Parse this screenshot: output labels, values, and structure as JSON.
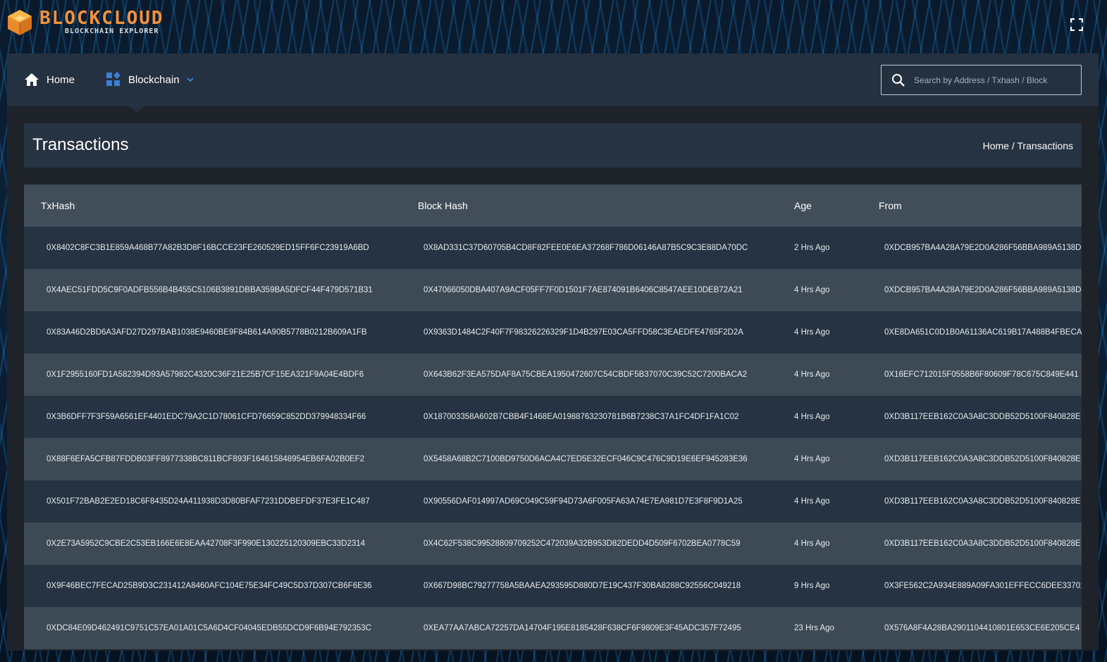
{
  "brand": {
    "name": "BLOCKCLOUD",
    "tagline": "BLOCKCHAIN EXPLORER",
    "accent": "#f4923a"
  },
  "nav": {
    "home_label": "Home",
    "blockchain_label": "Blockchain",
    "search_placeholder": "Search by Address / Txhash / Block"
  },
  "page": {
    "title": "Transactions",
    "breadcrumb_home": "Home",
    "breadcrumb_sep": "/",
    "breadcrumb_current": "Transactions"
  },
  "table": {
    "headers": {
      "txhash": "TxHash",
      "block_hash": "Block Hash",
      "age": "Age",
      "from": "From"
    },
    "rows": [
      {
        "txhash": "0X8402C8FC3B1E859A468B77A82B3D8F16BCCE23FE260529ED15FF6FC23919A6BD",
        "block_hash": "0X8AD331C37D60705B4CD8F82FEE0E6EA37268F786D06146A87B5C9C3E88DA70DC",
        "age": "2 Hrs Ago",
        "from": "0XDCB957BA4A28A79E2D0A286F56BBA989A5138D"
      },
      {
        "txhash": "0X4AEC51FDD5C9F0ADFB556B4B455C5106B3891DBBA359BA5DFCF44F479D571B31",
        "block_hash": "0X47066050DBA407A9ACF05FF7F0D1501F7AE874091B6406C8547AEE10DEB72A21",
        "age": "4 Hrs Ago",
        "from": "0XDCB957BA4A28A79E2D0A286F56BBA989A5138D"
      },
      {
        "txhash": "0X83A46D2BD6A3AFD27D297BAB1038E9460BE9F84B614A90B5778B0212B609A1FB",
        "block_hash": "0X9363D1484C2F40F7F98326226329F1D4B297E03CA5FFD58C3EAEDFE4765F2D2A",
        "age": "4 Hrs Ago",
        "from": "0XE8DA651C0D1B0A61136AC619B17A488B4FBECA"
      },
      {
        "txhash": "0X1F2955160FD1A582394D93A57982C4320C36F21E25B7CF15EA321F9A04E4BDF6",
        "block_hash": "0X643B62F3EA575DAF8A75CBEA1950472607C54CBDF5B37070C39C52C7200BACA2",
        "age": "4 Hrs Ago",
        "from": "0X16EFC712015F0558B6F80609F78C675C849E441"
      },
      {
        "txhash": "0X3B6DFF7F3F59A6561EF4401EDC79A2C1D78061CFD76659C852DD379948334F66",
        "block_hash": "0X187003358A602B7CBB4F1468EA01988763230781B6B7238C37A1FC4DF1FA1C02",
        "age": "4 Hrs Ago",
        "from": "0XD3B117EEB162C0A3A8C3DDB52D5100F840828E"
      },
      {
        "txhash": "0X88F6EFA5CFB87FDDB03FF8977338BC811BCF893F164615848954EB6FA02B0EF2",
        "block_hash": "0X5458A68B2C7100BD9750D6ACA4C7ED5E32ECF046C9C476C9D19E6EF945283E36",
        "age": "4 Hrs Ago",
        "from": "0XD3B117EEB162C0A3A8C3DDB52D5100F840828E"
      },
      {
        "txhash": "0X501F72BAB2E2ED18C6F8435D24A411938D3D80BFAF7231DDBEFDF37E3FE1C487",
        "block_hash": "0X90556DAF014997AD69C049C59F94D73A6F005FA63A74E7EA981D7E3F8F9D1A25",
        "age": "4 Hrs Ago",
        "from": "0XD3B117EEB162C0A3A8C3DDB52D5100F840828E"
      },
      {
        "txhash": "0X2E73A5952C9CBE2C53EB166E6E8EAA42708F3F990E130225120309EBC33D2314",
        "block_hash": "0X4C62F538C99528809709252C472039A32B953D82DEDD4D509F6702BEA0778C59",
        "age": "4 Hrs Ago",
        "from": "0XD3B117EEB162C0A3A8C3DDB52D5100F840828E"
      },
      {
        "txhash": "0X9F46BEC7FECAD25B9D3C231412A8460AFC104E75E34FC49C5D37D307CB6F6E36",
        "block_hash": "0X667D98BC79277758A5BAAEA293595D880D7E19C437F30BA8288C92556C049218",
        "age": "9 Hrs Ago",
        "from": "0X3FE562C2A934E889A09FA301EFFECC6DEE33701"
      },
      {
        "txhash": "0XDC84E09D462491C9751C57EA01A01C5A6D4CF04045EDB55DCD9F6B94E792353C",
        "block_hash": "0XEA77AA7ABCA72257DA14704F195E8185428F638CF6F9809E3F45ADC357F72495",
        "age": "23 Hrs Ago",
        "from": "0X576A8F4A28BA2901104410801E653CE6E205CE4"
      }
    ]
  }
}
